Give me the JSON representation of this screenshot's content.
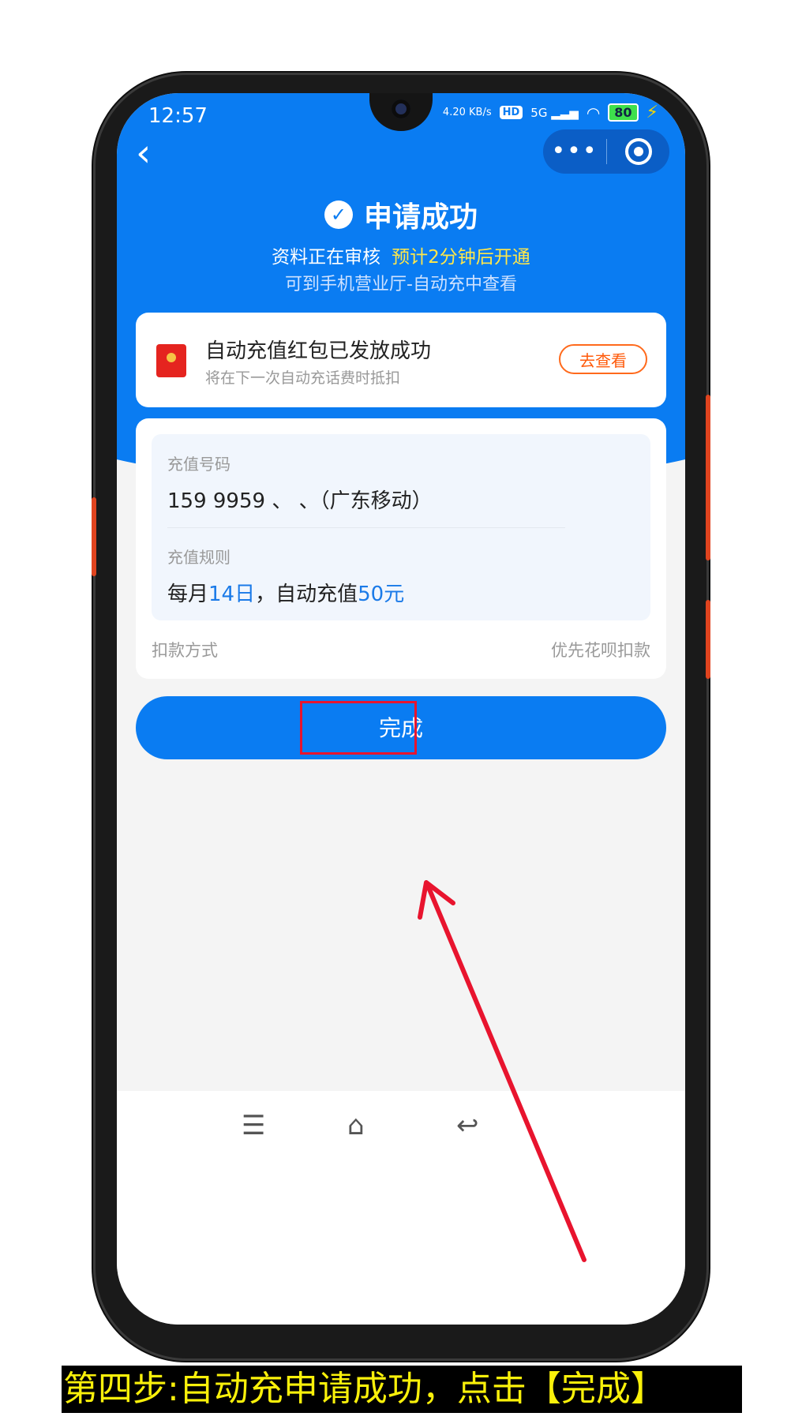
{
  "status_bar": {
    "time": "12:57",
    "speed": "4.20 KB/s",
    "hd": "HD",
    "network": "5G",
    "battery": "80"
  },
  "header": {
    "title": "申请成功",
    "subtitle_main": "资料正在审核",
    "subtitle_highlight": "预计2分钟后开通",
    "subtitle_secondary": "可到手机营业厅-自动充中查看"
  },
  "redpacket_card": {
    "title": "自动充值红包已发放成功",
    "subtitle": "将在下一次自动充话费时抵扣",
    "button_label": "去查看"
  },
  "recharge_info": {
    "number_label": "充值号码",
    "number_value": "159 9959 、   、（广东移动）",
    "rule_label": "充值规则",
    "rule_prefix": "每月",
    "rule_day": "14日",
    "rule_mid": "，自动充值",
    "rule_amount": "50元",
    "payment_label": "扣款方式",
    "payment_value": "优先花呗扣款"
  },
  "done_button_label": "完成",
  "caption": "第四步:自动充申请成功，点击【完成】",
  "colors": {
    "primary_blue": "#0a7cf2",
    "accent_orange": "#ff6a1c",
    "highlight_red": "#e8142e",
    "caption_yellow": "#f9f00a"
  }
}
